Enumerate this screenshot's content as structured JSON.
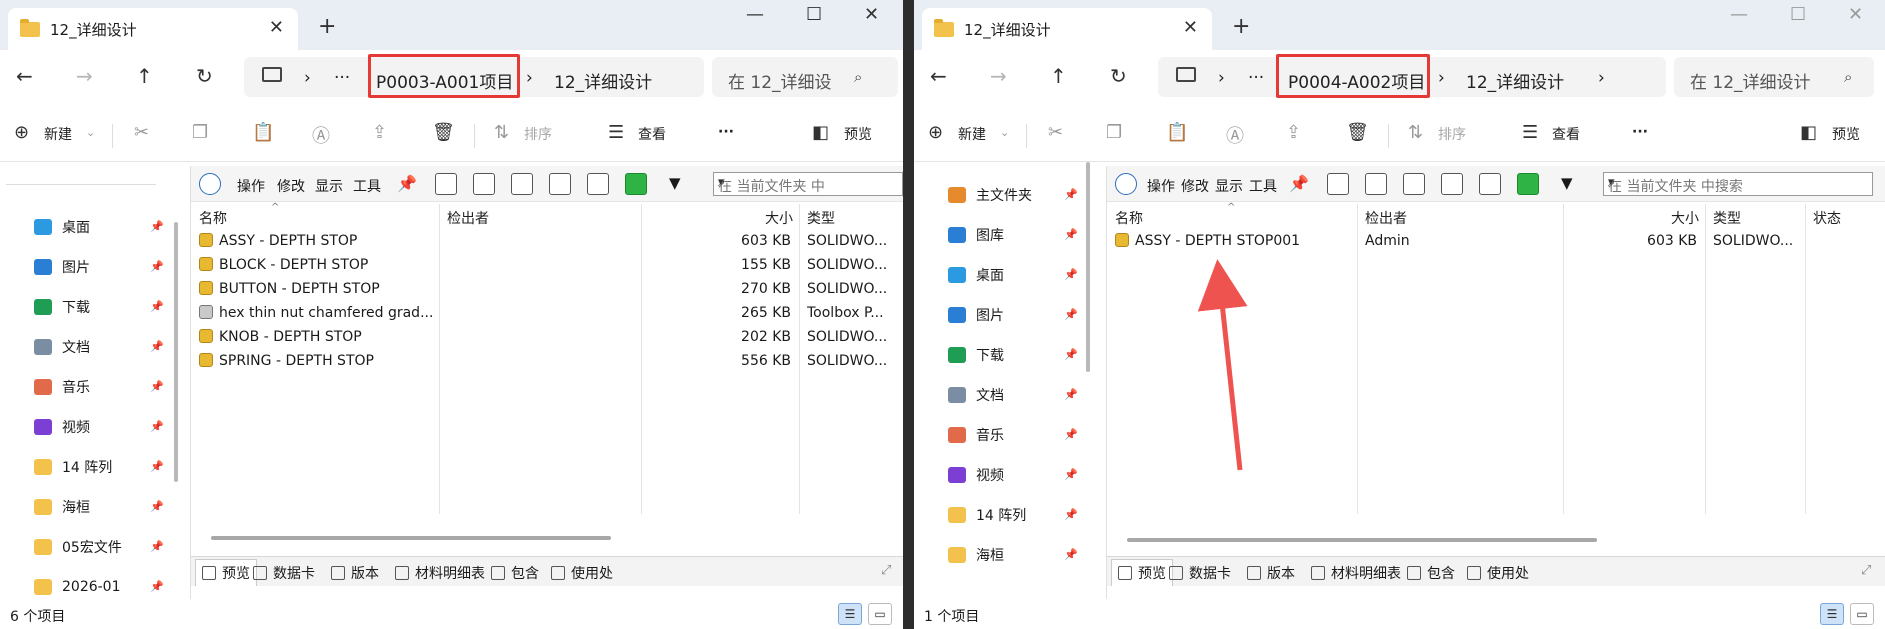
{
  "left": {
    "tab_title": "12_详细设计",
    "tab_close": "✕",
    "tab_add": "+",
    "win_min": "—",
    "win_max": "☐",
    "win_close": "✕",
    "address": {
      "ellipsis": "···",
      "segment1": "P0003-A001项目",
      "segment2": "12_详细设计",
      "sep": "›"
    },
    "search_placeholder": "在 12_详细设",
    "cmd": {
      "new": "新建",
      "sort": "排序",
      "view": "查看",
      "more": "···",
      "preview": "预览"
    },
    "nav_items": [
      {
        "label": "桌面",
        "icon": "desktop-icon",
        "color": "#2b9ae0"
      },
      {
        "label": "图片",
        "icon": "pictures-icon",
        "color": "#2a7fd4"
      },
      {
        "label": "下载",
        "icon": "download-icon",
        "color": "#1f9d55"
      },
      {
        "label": "文档",
        "icon": "documents-icon",
        "color": "#7a8da3"
      },
      {
        "label": "音乐",
        "icon": "music-icon",
        "color": "#e06a4a"
      },
      {
        "label": "视频",
        "icon": "videos-icon",
        "color": "#7b3fd4"
      },
      {
        "label": "14 阵列",
        "icon": "folder-icon",
        "color": "#f3c24c"
      },
      {
        "label": "海桓",
        "icon": "folder-icon",
        "color": "#f3c24c"
      },
      {
        "label": "05宏文件",
        "icon": "folder-icon",
        "color": "#f3c24c"
      },
      {
        "label": "2026-01",
        "icon": "folder-icon",
        "color": "#f3c24c"
      }
    ],
    "pdm_menu": {
      "ops": "操作",
      "modify": "修改",
      "display": "显示",
      "tools": "工具"
    },
    "pdm_search": "在 当前文件夹 中",
    "columns": {
      "name": "名称",
      "checkout": "检出者",
      "size": "大小",
      "type": "类型"
    },
    "files": [
      {
        "name": "ASSY - DEPTH STOP",
        "size": "603 KB",
        "type": "SOLIDWO...",
        "icon": "assembly-icon"
      },
      {
        "name": "BLOCK - DEPTH STOP",
        "size": "155 KB",
        "type": "SOLIDWO...",
        "icon": "part-icon"
      },
      {
        "name": "BUTTON - DEPTH STOP",
        "size": "270 KB",
        "type": "SOLIDWO...",
        "icon": "part-icon"
      },
      {
        "name": "hex thin nut chamfered grad...",
        "size": "265 KB",
        "type": "Toolbox P...",
        "icon": "toolbox-part-icon"
      },
      {
        "name": "KNOB - DEPTH STOP",
        "size": "202 KB",
        "type": "SOLIDWO...",
        "icon": "part-icon"
      },
      {
        "name": "SPRING - DEPTH STOP",
        "size": "556 KB",
        "type": "SOLIDWO...",
        "icon": "part-icon"
      }
    ],
    "bottom_tabs": [
      "预览",
      "数据卡",
      "版本",
      "材料明细表",
      "包含",
      "使用处"
    ],
    "status": "6 个项目"
  },
  "right": {
    "tab_title": "12_详细设计",
    "tab_close": "✕",
    "tab_add": "+",
    "win_min": "—",
    "win_max": "☐",
    "win_close": "✕",
    "address": {
      "ellipsis": "···",
      "segment1": "P0004-A002项目",
      "segment2": "12_详细设计",
      "sep": "›"
    },
    "search_placeholder": "在 12_详细设计",
    "cmd": {
      "new": "新建",
      "sort": "排序",
      "view": "查看",
      "more": "···",
      "preview": "预览"
    },
    "nav_items": [
      {
        "label": "主文件夹",
        "icon": "home-icon",
        "color": "#e68a2e"
      },
      {
        "label": "图库",
        "icon": "gallery-icon",
        "color": "#2a7fd4"
      },
      {
        "label": "桌面",
        "icon": "desktop-icon",
        "color": "#2b9ae0"
      },
      {
        "label": "图片",
        "icon": "pictures-icon",
        "color": "#2a7fd4"
      },
      {
        "label": "下载",
        "icon": "download-icon",
        "color": "#1f9d55"
      },
      {
        "label": "文档",
        "icon": "documents-icon",
        "color": "#7a8da3"
      },
      {
        "label": "音乐",
        "icon": "music-icon",
        "color": "#e06a4a"
      },
      {
        "label": "视频",
        "icon": "videos-icon",
        "color": "#7b3fd4"
      },
      {
        "label": "14 阵列",
        "icon": "folder-icon",
        "color": "#f3c24c"
      },
      {
        "label": "海桓",
        "icon": "folder-icon",
        "color": "#f3c24c"
      }
    ],
    "pdm_menu": {
      "ops": "操作",
      "modify": "修改",
      "display": "显示",
      "tools": "工具"
    },
    "pdm_search": "在 当前文件夹 中搜索",
    "columns": {
      "name": "名称",
      "checkout": "检出者",
      "size": "大小",
      "type": "类型",
      "state": "状态"
    },
    "files": [
      {
        "name": "ASSY - DEPTH STOP001",
        "checkout": "Admin",
        "size": "603 KB",
        "type": "SOLIDWO...",
        "icon": "assembly-icon"
      }
    ],
    "bottom_tabs": [
      "预览",
      "数据卡",
      "版本",
      "材料明细表",
      "包含",
      "使用处"
    ],
    "status": "1 个项目"
  },
  "colors": {
    "highlight": "#e53935",
    "arrow": "#ef5350",
    "titlebar": "#e9eef5"
  }
}
